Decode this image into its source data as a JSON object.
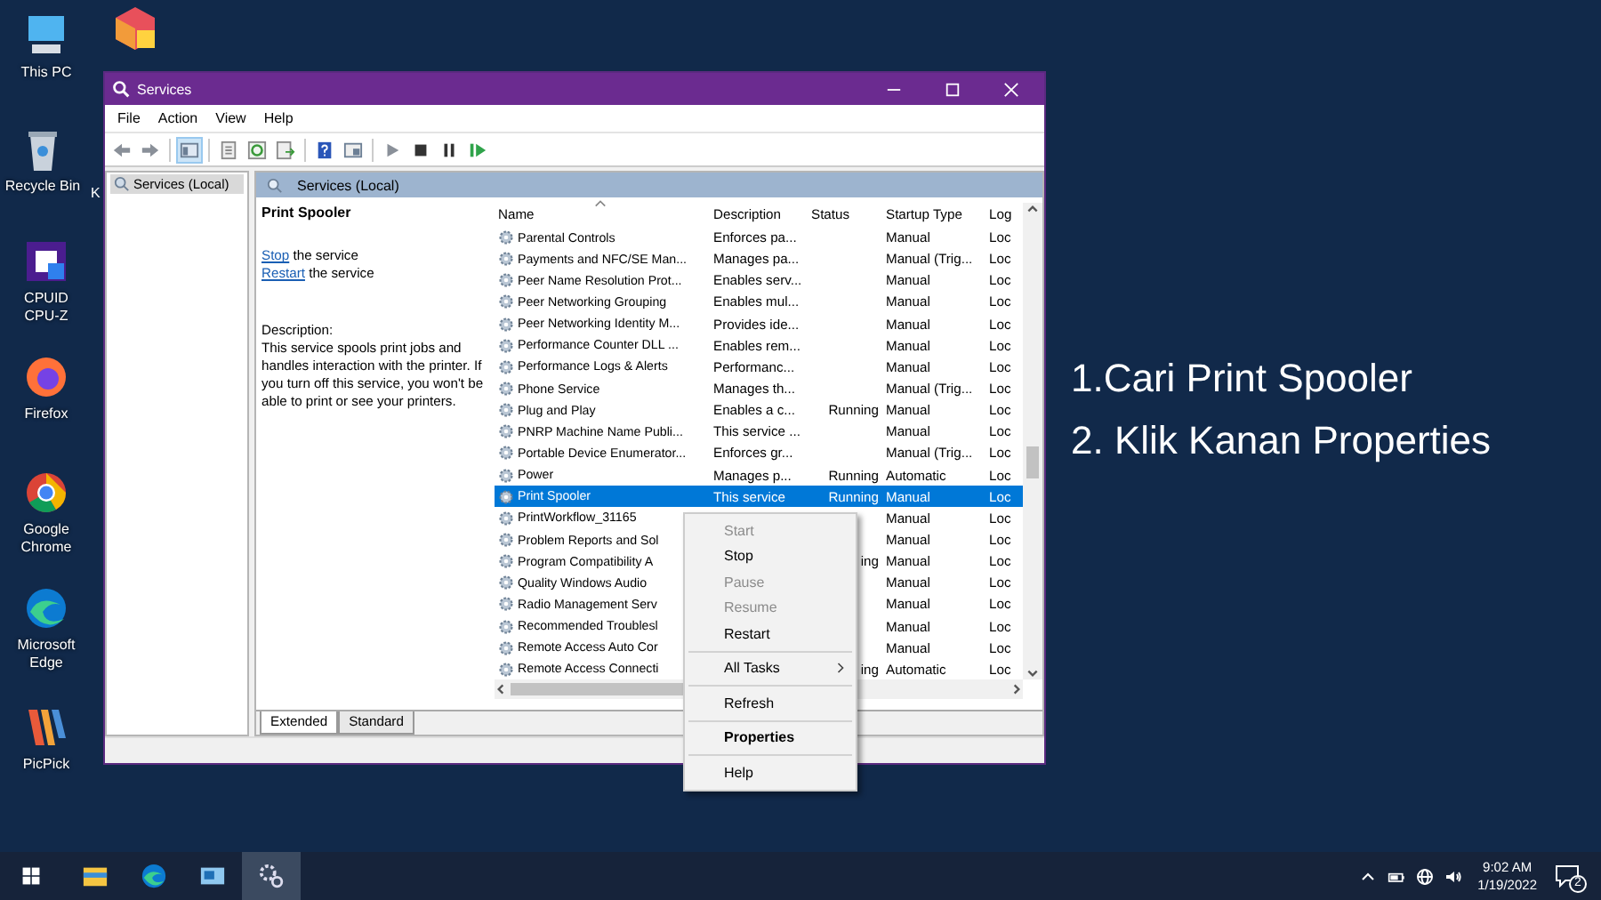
{
  "desktop_icons": [
    {
      "kind": "pc",
      "label": "This PC"
    },
    {
      "kind": "cube"
    },
    {
      "kind": "bin",
      "label": "Recycle Bin"
    },
    {
      "kind": "cpu",
      "label": "CPUID CPU-Z"
    },
    {
      "kind": "firefox",
      "label": "Firefox"
    },
    {
      "kind": "chrome",
      "label": "Google Chrome"
    },
    {
      "kind": "edge",
      "label": "Microsoft Edge"
    },
    {
      "kind": "picpick",
      "label": "PicPick"
    }
  ],
  "hidden_icon_label": "K",
  "window": {
    "title": "Services",
    "menu": [
      "File",
      "Action",
      "View",
      "Help"
    ],
    "toolbar": [
      {
        "kind": "back",
        "on": false
      },
      {
        "kind": "forward",
        "on": false
      },
      {
        "kind": "sep"
      },
      {
        "kind": "tree",
        "on": true
      },
      {
        "kind": "sep"
      },
      {
        "kind": "sheet",
        "on": false
      },
      {
        "kind": "refresh",
        "on": false
      },
      {
        "kind": "export",
        "on": false
      },
      {
        "kind": "sep"
      },
      {
        "kind": "help",
        "on": false
      },
      {
        "kind": "view",
        "on": false
      },
      {
        "kind": "sep"
      },
      {
        "kind": "play",
        "on": false
      },
      {
        "kind": "stop",
        "on": false
      },
      {
        "kind": "pause",
        "on": false
      },
      {
        "kind": "resume",
        "on": false
      }
    ],
    "tree": [
      {
        "label": "Services (Local)",
        "selected": true
      }
    ],
    "pane_header": "Services (Local)",
    "details": {
      "title": "Print Spooler",
      "actions": [
        {
          "link": "Stop",
          "text": " the service"
        },
        {
          "link": "Restart",
          "text": " the service"
        }
      ],
      "description_label": "Description:",
      "description": "This service spools print jobs and handles interaction with the printer. If you turn off this service, you won't be able to print or see your printers."
    },
    "table": {
      "columns": [
        "Name",
        "Description",
        "Status",
        "Startup Type",
        "Log"
      ],
      "rows": [
        {
          "name": "Parental Controls",
          "description": "Enforces pa...",
          "startup": "Manual",
          "logon": "Loc",
          "selected": false
        },
        {
          "name": "Payments and NFC/SE Man...",
          "description": "Manages pa...",
          "startup": "Manual (Trig...",
          "logon": "Loc",
          "selected": false
        },
        {
          "name": "Peer Name Resolution Prot...",
          "description": "Enables serv...",
          "startup": "Manual",
          "logon": "Loc",
          "selected": false
        },
        {
          "name": "Peer Networking Grouping",
          "description": "Enables mul...",
          "startup": "Manual",
          "logon": "Loc",
          "selected": false
        },
        {
          "name": "Peer Networking Identity M...",
          "description": "Provides ide...",
          "startup": "Manual",
          "logon": "Loc",
          "selected": false
        },
        {
          "name": "Performance Counter DLL ...",
          "description": "Enables rem...",
          "startup": "Manual",
          "logon": "Loc",
          "selected": false
        },
        {
          "name": "Performance Logs & Alerts",
          "description": "Performanc...",
          "startup": "Manual",
          "logon": "Loc",
          "selected": false
        },
        {
          "name": "Phone Service",
          "description": "Manages th...",
          "startup": "Manual (Trig...",
          "logon": "Loc",
          "selected": false
        },
        {
          "name": "Plug and Play",
          "description": "Enables a c...",
          "status": "Running",
          "startup": "Manual",
          "logon": "Loc",
          "selected": false
        },
        {
          "name": "PNRP Machine Name Publi...",
          "description": "This service ...",
          "startup": "Manual",
          "logon": "Loc",
          "selected": false
        },
        {
          "name": "Portable Device Enumerator...",
          "description": "Enforces gr...",
          "startup": "Manual (Trig...",
          "logon": "Loc",
          "selected": false
        },
        {
          "name": "Power",
          "description": "Manages p...",
          "status": "Running",
          "startup": "Automatic",
          "logon": "Loc",
          "selected": false
        },
        {
          "name": "Print Spooler",
          "description": "This service",
          "status": "Running",
          "startup": "Manual",
          "logon": "Loc",
          "selected": true
        },
        {
          "name": "PrintWorkflow_31165",
          "startup": "Manual",
          "logon": "Loc",
          "selected": false
        },
        {
          "name": "Problem Reports and Sol",
          "startup": "Manual",
          "logon": "Loc",
          "selected": false
        },
        {
          "name": "Program Compatibility A",
          "status": "ing",
          "startup": "Manual",
          "logon": "Loc",
          "selected": false
        },
        {
          "name": "Quality Windows Audio",
          "startup": "Manual",
          "logon": "Loc",
          "selected": false
        },
        {
          "name": "Radio Management Serv",
          "startup": "Manual",
          "logon": "Loc",
          "selected": false
        },
        {
          "name": "Recommended Troublesl",
          "startup": "Manual",
          "logon": "Loc",
          "selected": false
        },
        {
          "name": "Remote Access Auto Cor",
          "startup": "Manual",
          "logon": "Loc",
          "selected": false
        },
        {
          "name": "Remote Access Connecti",
          "status": "ing",
          "startup": "Automatic",
          "logon": "Loc",
          "selected": false
        }
      ]
    },
    "tabs": [
      {
        "label": "Extended",
        "selected": true
      },
      {
        "label": "Standard",
        "selected": false
      }
    ]
  },
  "context_menu": [
    {
      "kind": "item",
      "label": "Start",
      "disabled": true
    },
    {
      "kind": "item",
      "label": "Stop",
      "disabled": false
    },
    {
      "kind": "item",
      "label": "Pause",
      "disabled": true
    },
    {
      "kind": "item",
      "label": "Resume",
      "disabled": true
    },
    {
      "kind": "item",
      "label": "Restart",
      "disabled": false
    },
    {
      "kind": "separator"
    },
    {
      "kind": "submenu",
      "label": "All Tasks",
      "disabled": false
    },
    {
      "kind": "separator"
    },
    {
      "kind": "item",
      "label": "Refresh",
      "disabled": false
    },
    {
      "kind": "separator"
    },
    {
      "kind": "default",
      "label": "Properties",
      "disabled": false
    },
    {
      "kind": "separator"
    },
    {
      "kind": "item",
      "label": "Help",
      "disabled": false
    }
  ],
  "instructions": [
    "1.Cari Print Spooler",
    "2. Klik Kanan Properties"
  ],
  "taskbar": {
    "apps": [
      {
        "kind": "explorer",
        "selected": false
      },
      {
        "kind": "edge",
        "selected": false
      },
      {
        "kind": "app",
        "selected": false
      },
      {
        "kind": "services",
        "selected": true
      }
    ],
    "time": "9:02 AM",
    "date": "1/19/2022",
    "notifications": "2"
  }
}
